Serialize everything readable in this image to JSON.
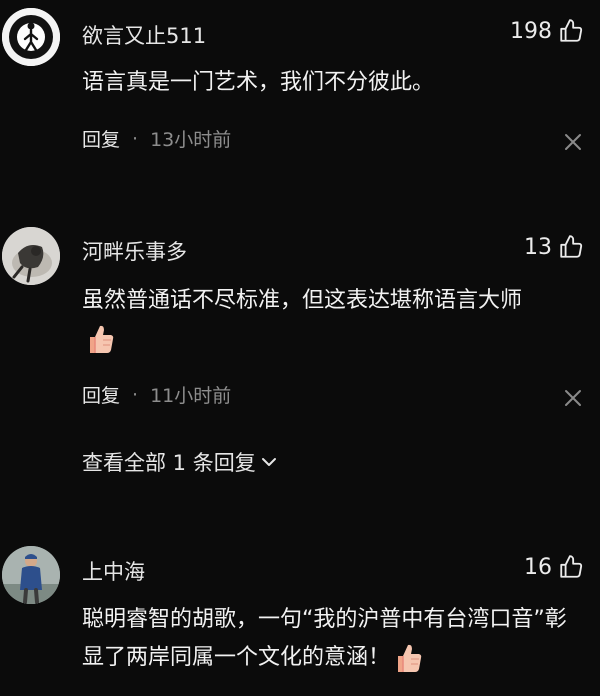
{
  "comments": [
    {
      "username": "欲言又止511",
      "likes": "198",
      "text": "语言真是一门艺术，我们不分彼此。",
      "reply_label": "回复",
      "separator": "·",
      "time": "13小时前"
    },
    {
      "username": "河畔乐事多",
      "likes": "13",
      "text": "虽然普通话不尽标准，但这表达堪称语言大师",
      "reply_label": "回复",
      "separator": "·",
      "time": "11小时前",
      "view_replies": "查看全部 1 条回复"
    },
    {
      "username": "上中海",
      "likes": "16",
      "text": "聪明睿智的胡歌，一句“我的沪普中有台湾口音”彰显了两岸同属一个文化的意涵！"
    }
  ],
  "colors": {
    "background": "#0b0b0b",
    "text_primary": "#f2f2f2",
    "text_secondary": "#8d8d8d"
  },
  "icons": {
    "like": "thumbs-up-outline-icon",
    "close": "close-x-icon",
    "chevron": "chevron-down-icon",
    "emoji": "thumbs-up-emoji-icon"
  }
}
